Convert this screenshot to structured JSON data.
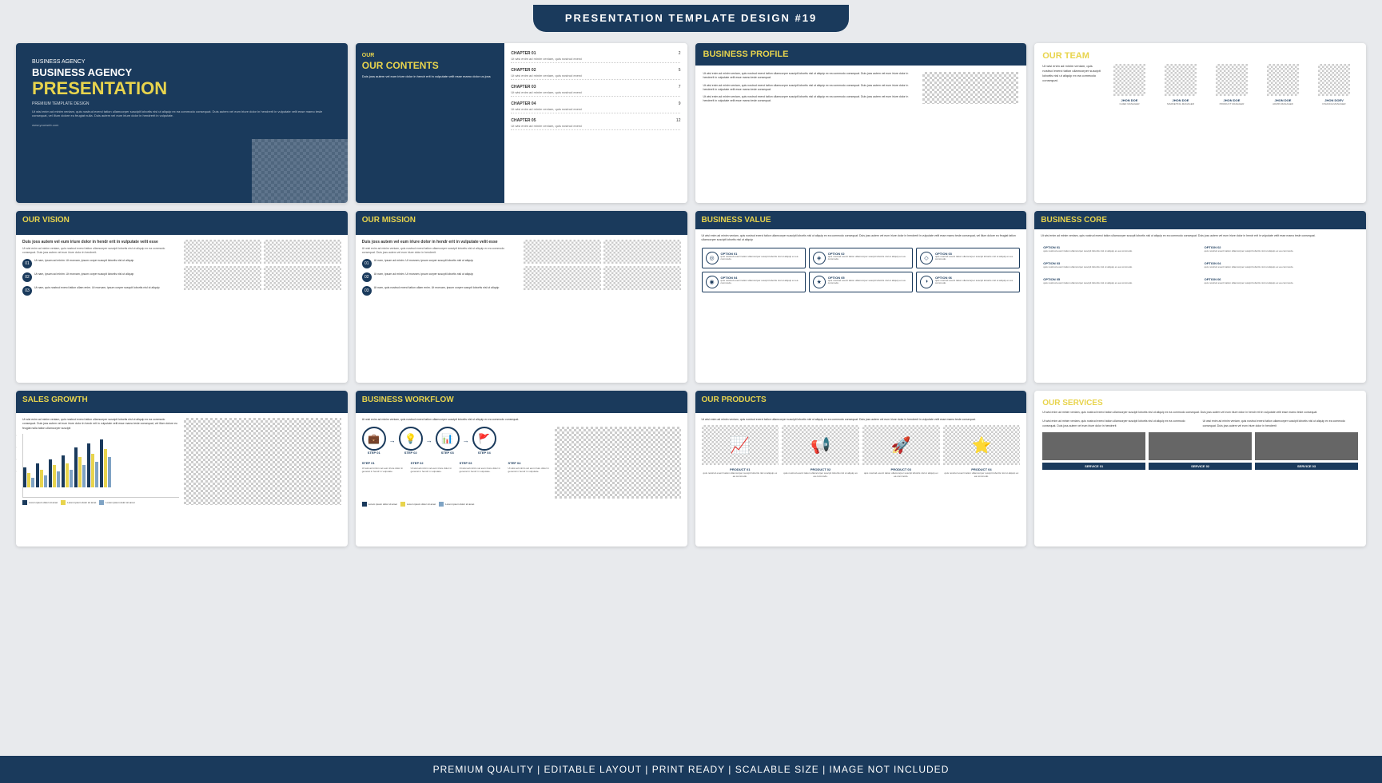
{
  "header": {
    "title": "PRESENTATION TEMPLATE DESIGN #19"
  },
  "footer": {
    "text": "PREMIUM QUALITY  |  EDITABLE LAYOUT  |  PRINT READY  |  SCALABLE SIZE  |  IMAGE NOT INCLUDED"
  },
  "slides": {
    "slide1": {
      "subtitle": "BUSINESS AGENCY",
      "title": "PRESENTATION",
      "tagline": "PREMIUM TEMPLATE DESIGN",
      "desc": "Ut wisi enim ad minim veniam, quis nostrud exerci tation ullamcorper suscipit lobortis nisl ut aliquip ex ea commodo consequat. Duis autem vel eum iriure dolor in hendrerit in vulputate velit esse mamo tesle consequat, vel illum dolore eu feugiat nulla. Duis autem vel eum iriure dolor in hendrerit in vulputate.",
      "url": "www.yourweb.com"
    },
    "slide2": {
      "title": "OUR CONTENTS",
      "chapters": [
        {
          "label": "CHAPTER 01",
          "num": "2"
        },
        {
          "label": "CHAPTER 02",
          "num": "5"
        },
        {
          "label": "CHAPTER 03",
          "num": "7"
        },
        {
          "label": "CHAPTER 04",
          "num": "9"
        },
        {
          "label": "CHAPTER 05",
          "num": "12"
        }
      ],
      "desc": "Duis joss autem vel eum iriure dolor in hendr erit in vulputate velit esse mamo dolor us joss"
    },
    "slide3": {
      "title": "BUSINESS PROFILE",
      "desc": "Ut wisi enim ad minim veniam, quis nostrud exerci tation ullamcorper suscipit lobortis nisl ut aliquip ex ea commodo consequat. Duis joss autem vel eum iriure dolor in hendrerit in vulputate velit esse mamo tesle consequat, vel illum dolore eu feugiat"
    },
    "slide4": {
      "title": "OUR TEAM",
      "desc": "Ut wisi enim ad minim veniam, quis nostrud exerci tation ullamcorper suscipit lobortis nisl ut aliquip ex ea commodo consequat.",
      "members": [
        {
          "name": "JHON DOE",
          "role": "CHIEF MANAGER"
        },
        {
          "name": "JHON DOE",
          "role": "MARKETING MANAGER"
        },
        {
          "name": "JHON DOE",
          "role": "PRODUCT MANAGER"
        },
        {
          "name": "JHON DOE",
          "role": "ADMIN MANAGER"
        },
        {
          "name": "JHON DOEV",
          "role": "FINANCE MANAGER"
        }
      ]
    },
    "slide5": {
      "title": "OUR VISION",
      "subtitle": "Duis joss autem vel eum iriure dolor in hendr erit in vulputate velit esse",
      "desc": "Ut wisi enim ad minim veniam, quis nostrud exerci tation ullamcorper suscipit lobortis nisl ut aliquip ex ea commodo consequat. Duis joss autem vel eum iriure dolor in hendrerit.",
      "items": [
        {
          "num": "01",
          "text": "Ut nam, ipsum ad minim. Ut morvam, ipsum corper suscpit lobortis nisl ut aliquip"
        },
        {
          "num": "02",
          "text": "Ut nam, ipsum ad minim. Ut morvam, ipsum corper suscpit lobortis nisl ut aliquip"
        },
        {
          "num": "03",
          "text": "Ut nam, quis nostrud exerci tation ullam enim. Ut morvam, ipsum corper suscpit lobortis nisl ut aliquip"
        }
      ]
    },
    "slide6": {
      "title": "OUR MISSION",
      "subtitle": "Duis joss autem vel eum iriure dolor in hendr erit in vulputate velit esse",
      "desc": "Ut wisi enim ad minim veniam, quis nostrud exerci tation ullamcorper suscipit lobortis nisl ut aliquip ex ea commodo consequat. Duis joss autem vel eum iriure dolor in hendrerit.",
      "items": [
        {
          "num": "01",
          "text": "Ut nam, ipsum ad minim. Ut morvam, ipsum corper suscpit lobortis nisl ut aliquip"
        },
        {
          "num": "02",
          "text": "Ut nam, ipsum ad minim. Ut morvam, ipsum corper suscpit lobortis nisl ut aliquip"
        },
        {
          "num": "03",
          "text": "Ut nam, quis nostrud exerci tation ullam enim. Ut morvam, ipsum corper suscpit lobortis nisl ut aliquip"
        }
      ]
    },
    "slide7": {
      "title": "BUSINESS VALUE",
      "desc": "Ut wisi enim ad minim veniam, quis nostrud exerci tation ullamcorper suscipit lobortis nisl ut aliquip ex ea commodo consequat. Duis joss autem vel eum iriure dolor in hendrerit in vulputate velit esse mamo tesle consequat, vel illum dolore eu feugiat tation ullamcorper suscipit lobortis nisl ut aliquip",
      "options": [
        {
          "label": "OPTION 01",
          "icon": "◎",
          "desc": "quis nostrud exerci tation ullamcorper suscpit lobortis nisl ut aliquip ex ea commodo consequat."
        },
        {
          "label": "OPTION 02",
          "icon": "◈",
          "desc": "quis nostrud exerci tation ullamcorper suscpit lobortis nisl ut aliquip ex ea commodo consequat."
        },
        {
          "label": "OPTION 03",
          "icon": "◇",
          "desc": "quis nostrud exerci tation ullamcorper suscpit lobortis nisl ut aliquip ex ea commodo consequat."
        },
        {
          "label": "OPTION 04",
          "icon": "◉",
          "desc": "quis nostrud exerci tation ullamcorper suscpit lobortis nisl ut aliquip ex ea commodo consequat."
        },
        {
          "label": "OPTION 05",
          "icon": "★",
          "desc": "quis nostrud exerci tation ullamcorper suscpit lobortis nisl ut aliquip ex ea commodo consequat."
        },
        {
          "label": "OPTION 06",
          "icon": "◑",
          "desc": "quis nostrud exerci tation ullamcorper suscpit lobortis nisl ut aliquip ex ea commodo consequat."
        }
      ]
    },
    "slide8": {
      "title": "BUSINESS CORE",
      "desc": "Ut wisi enim ad minim veniam, quis nostrud exerci tation ullamcorper suscpit lobortis nisl ut aliquip ex ea commodo consequat. Duis joss autem vel eum iriure dolor in hendr erit in vulputate velit esse mamo tesle consequat.",
      "options": [
        {
          "label": "OPTION 01",
          "desc": "quis nostrud exerci tation ullamcorper suscpit lobortis nisl ut aliquip ex ea commodo consequat."
        },
        {
          "label": "OPTION 02",
          "desc": "quis nostrud exerci tation ullamcorper suscpit lobortis nisl ut aliquip ex ea commodo consequat."
        },
        {
          "label": "OPTION 03",
          "desc": "quis nostrud exerci tation ullamcorper suscpit lobortis nisl ut aliquip ex ea commodo consequat."
        },
        {
          "label": "OPTION 04",
          "desc": "quis nostrud exerci tation ullamcorper suscpit lobortis nisl ut aliquip ex ea commodo consequat."
        },
        {
          "label": "OPTION 05",
          "desc": "quis nostrud exerci tation ullamcorper suscpit lobortis nisl ut aliquip ex ea commodo consequat."
        },
        {
          "label": "OPTION 06",
          "desc": "quis nostrud exerci tation ullamcorper suscpit lobortis nisl ut aliquip ex ea commodo consequat."
        }
      ]
    },
    "slide9": {
      "title": "SALES GROWTH",
      "desc": "Ut wisi enim ad minim veniam, quis nostrud exerci tation ullamcorper suscipit lobortis nisl ut aliquip ex ea commodo consequat. Duis joss autem vel eum iriure dolor in hendr erit in vulputate velit esse mamo tesle consequat, vel illum dolore eu feugiat nulla tation ullamcorper suscipit"
    },
    "slide10": {
      "title": "BUSINESS WORKFLOW",
      "desc": "Ut wisi enim ad minim veniam, quis nostrud exerci tation ullamcorper suscipit lobortis nisl ut aliquip ex ea commodo consequat.",
      "steps": [
        "STEP 01",
        "STEP 02",
        "STEP 03",
        "STEP 04"
      ]
    },
    "slide11": {
      "title": "OUR PRODUCTS",
      "desc": "Ut wisi enim ad minim veniam, quis nostrud exerci tation ullamcorper suscipit lobortis nisl ut aliquip ex ea commodo consequat. Duis joss autem vel eum iriure dolor in hendrerit in vulputate velit esse mamo tesle consequat.",
      "products": [
        {
          "label": "PRODUCT 01",
          "icon": "📈"
        },
        {
          "label": "PRODUCT 02",
          "icon": "📢"
        },
        {
          "label": "PRODUCT 03",
          "icon": "🚀"
        },
        {
          "label": "PRODUCT 04",
          "icon": "⭐"
        }
      ]
    },
    "slide12": {
      "title": "OUR SERVICES",
      "desc": "Ut wisi enim ad minim veniam, quis nostrud exerci tation ullamcorper suscipit lobortis nisl ut aliquip ex ea commodo consequat. Duis joss autem vel eum iriure dolor in hendr erit in vulputate velit esse mamo tesle consequat",
      "services": [
        {
          "label": "SERVICE 01"
        },
        {
          "label": "SERVICE 02"
        },
        {
          "label": "SERVICE 03"
        }
      ]
    }
  }
}
